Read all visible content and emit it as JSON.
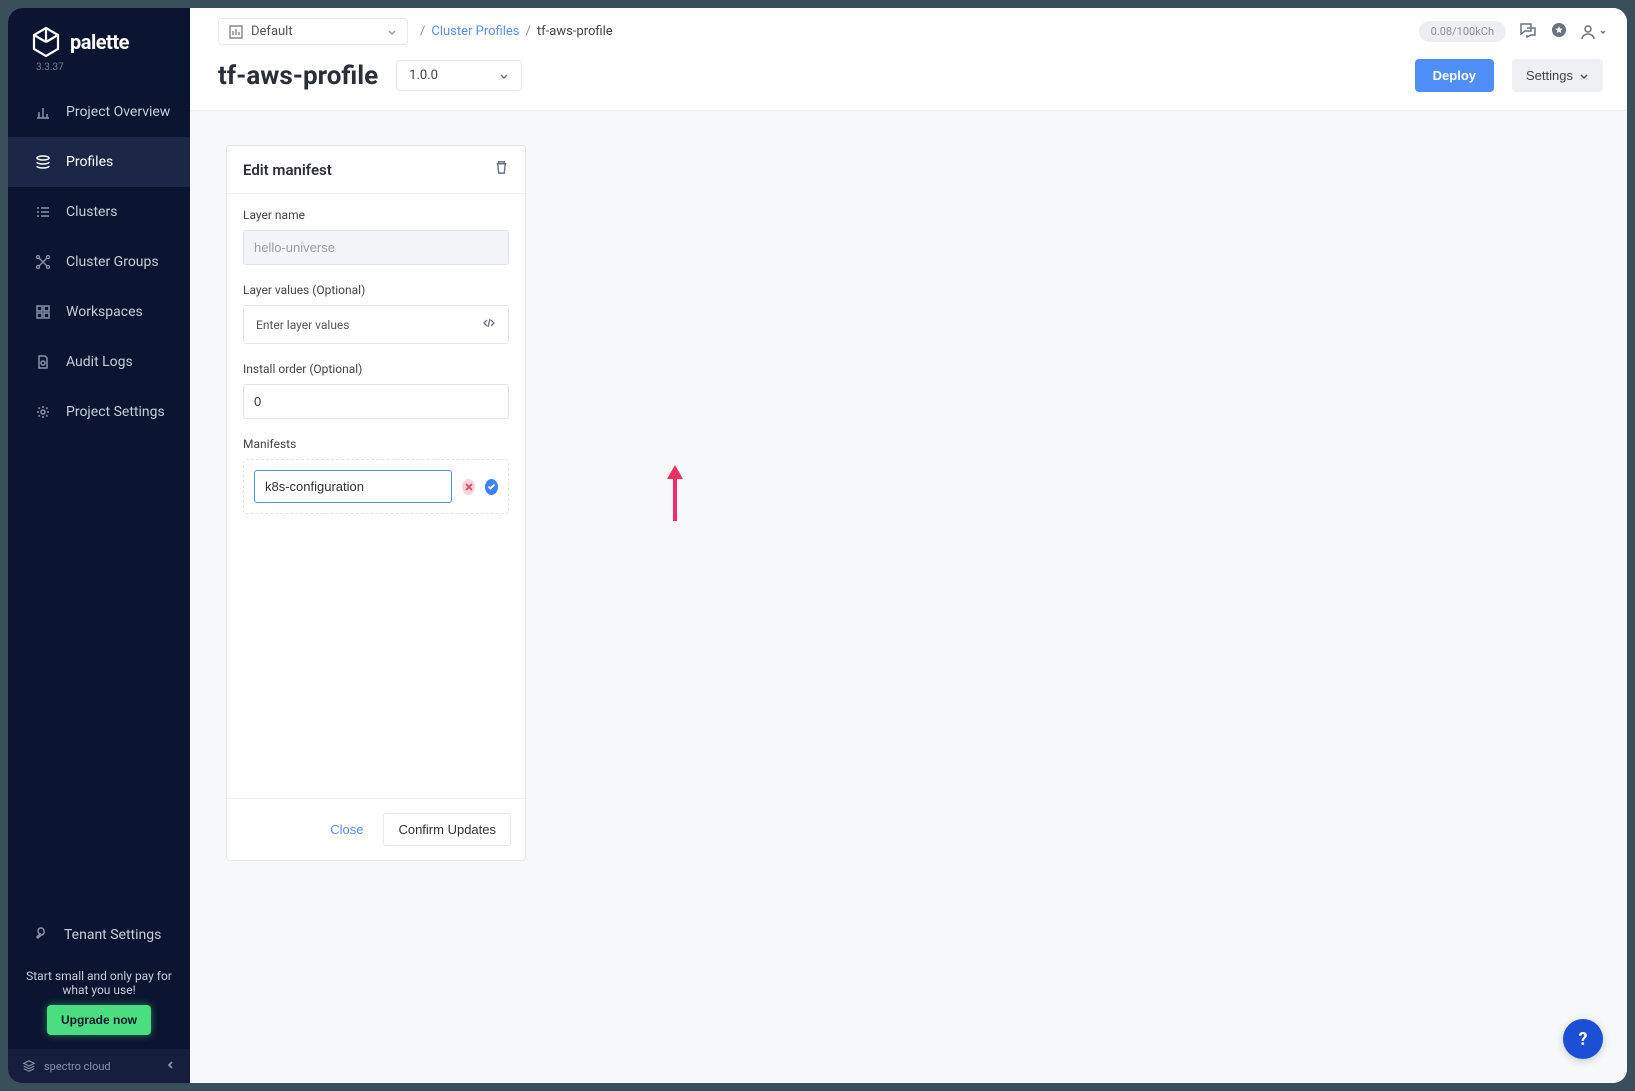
{
  "brand": {
    "name": "palette",
    "version": "3.3.37",
    "footer": "spectro cloud"
  },
  "sidebar": {
    "items": [
      {
        "label": "Project Overview"
      },
      {
        "label": "Profiles"
      },
      {
        "label": "Clusters"
      },
      {
        "label": "Cluster Groups"
      },
      {
        "label": "Workspaces"
      },
      {
        "label": "Audit Logs"
      },
      {
        "label": "Project Settings"
      }
    ],
    "tenant": "Tenant Settings",
    "promo": "Start small and only pay for what you use!",
    "upgrade": "Upgrade now"
  },
  "topbar": {
    "project": "Default",
    "breadcrumb_link": "Cluster Profiles",
    "breadcrumb_current": "tf-aws-profile",
    "credits": "0.08/100kCh"
  },
  "page": {
    "title": "tf-aws-profile",
    "version": "1.0.0",
    "deploy": "Deploy",
    "settings": "Settings"
  },
  "panel": {
    "title": "Edit manifest",
    "layer_name_label": "Layer name",
    "layer_name_value": "hello-universe",
    "layer_values_label": "Layer values (Optional)",
    "layer_values_placeholder": "Enter layer values",
    "install_order_label": "Install order (Optional)",
    "install_order_value": "0",
    "manifests_label": "Manifests",
    "manifest_input": "k8s-configuration",
    "close": "Close",
    "confirm": "Confirm Updates"
  },
  "help": "?"
}
